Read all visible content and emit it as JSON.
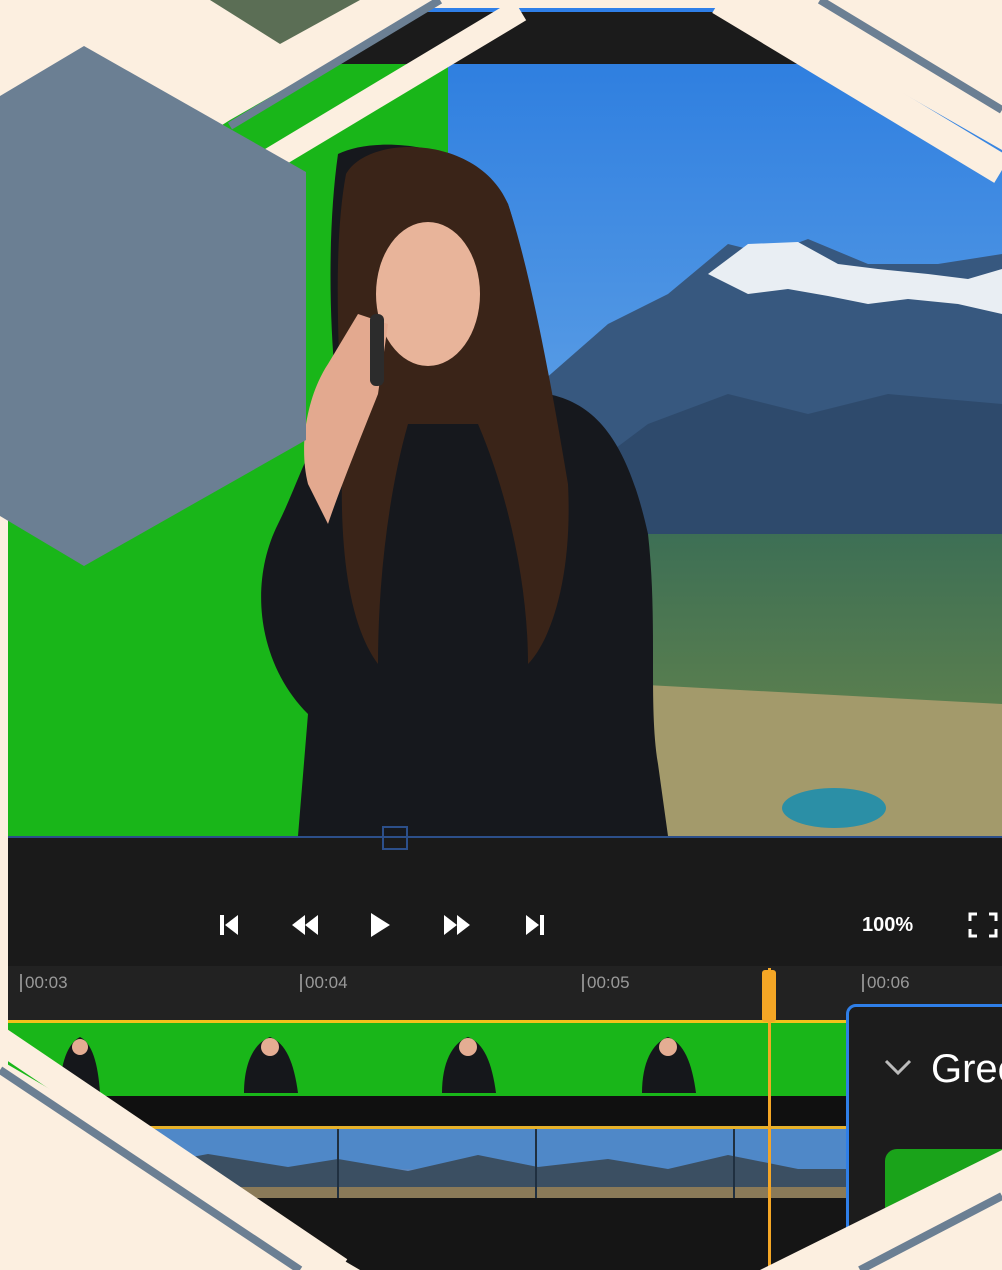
{
  "preview": {
    "greenscreen_color": "#19b619",
    "sky_color": "#3f8fe0"
  },
  "controls": {
    "zoom_label": "100%"
  },
  "ruler": {
    "ticks": [
      "00:03",
      "00:04",
      "00:05",
      "00:06"
    ]
  },
  "panel": {
    "title": "Gree"
  },
  "colors": {
    "accent": "#2f7fe8",
    "playhead": "#f4a625",
    "track_border": "#f2c21a",
    "background": "#fcefe0",
    "hex_gray": "#6b7f93",
    "hex_green": "#5b6e55"
  }
}
